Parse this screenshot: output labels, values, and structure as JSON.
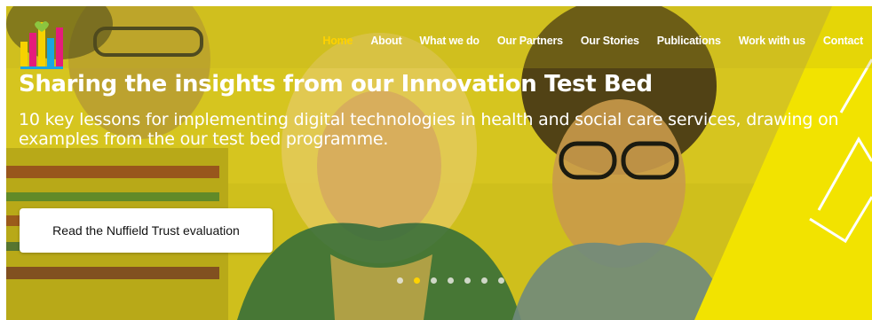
{
  "logo": {
    "icon": "bar-chart-heart-logo",
    "colors": [
      "#f7d200",
      "#e51c7b",
      "#1aa6e0",
      "#8cc63f"
    ]
  },
  "nav": {
    "items": [
      {
        "label": "Home",
        "active": true
      },
      {
        "label": "About"
      },
      {
        "label": "What we do"
      },
      {
        "label": "Our Partners"
      },
      {
        "label": "Our Stories"
      },
      {
        "label": "Publications"
      },
      {
        "label": "Work with us"
      },
      {
        "label": "Contact"
      }
    ]
  },
  "hero": {
    "title": "Sharing the insights from our Innovation Test Bed",
    "subtitle": "10 key lessons for implementing digital technologies in health and social care services, drawing on examples from the our test bed programme.",
    "cta_label": "Read the Nuffield Trust evaluation"
  },
  "carousel": {
    "slide_count": 7,
    "active_index": 1
  },
  "colors": {
    "accent": "#ffd200",
    "overlay": "#d6c419",
    "text": "#ffffff"
  }
}
